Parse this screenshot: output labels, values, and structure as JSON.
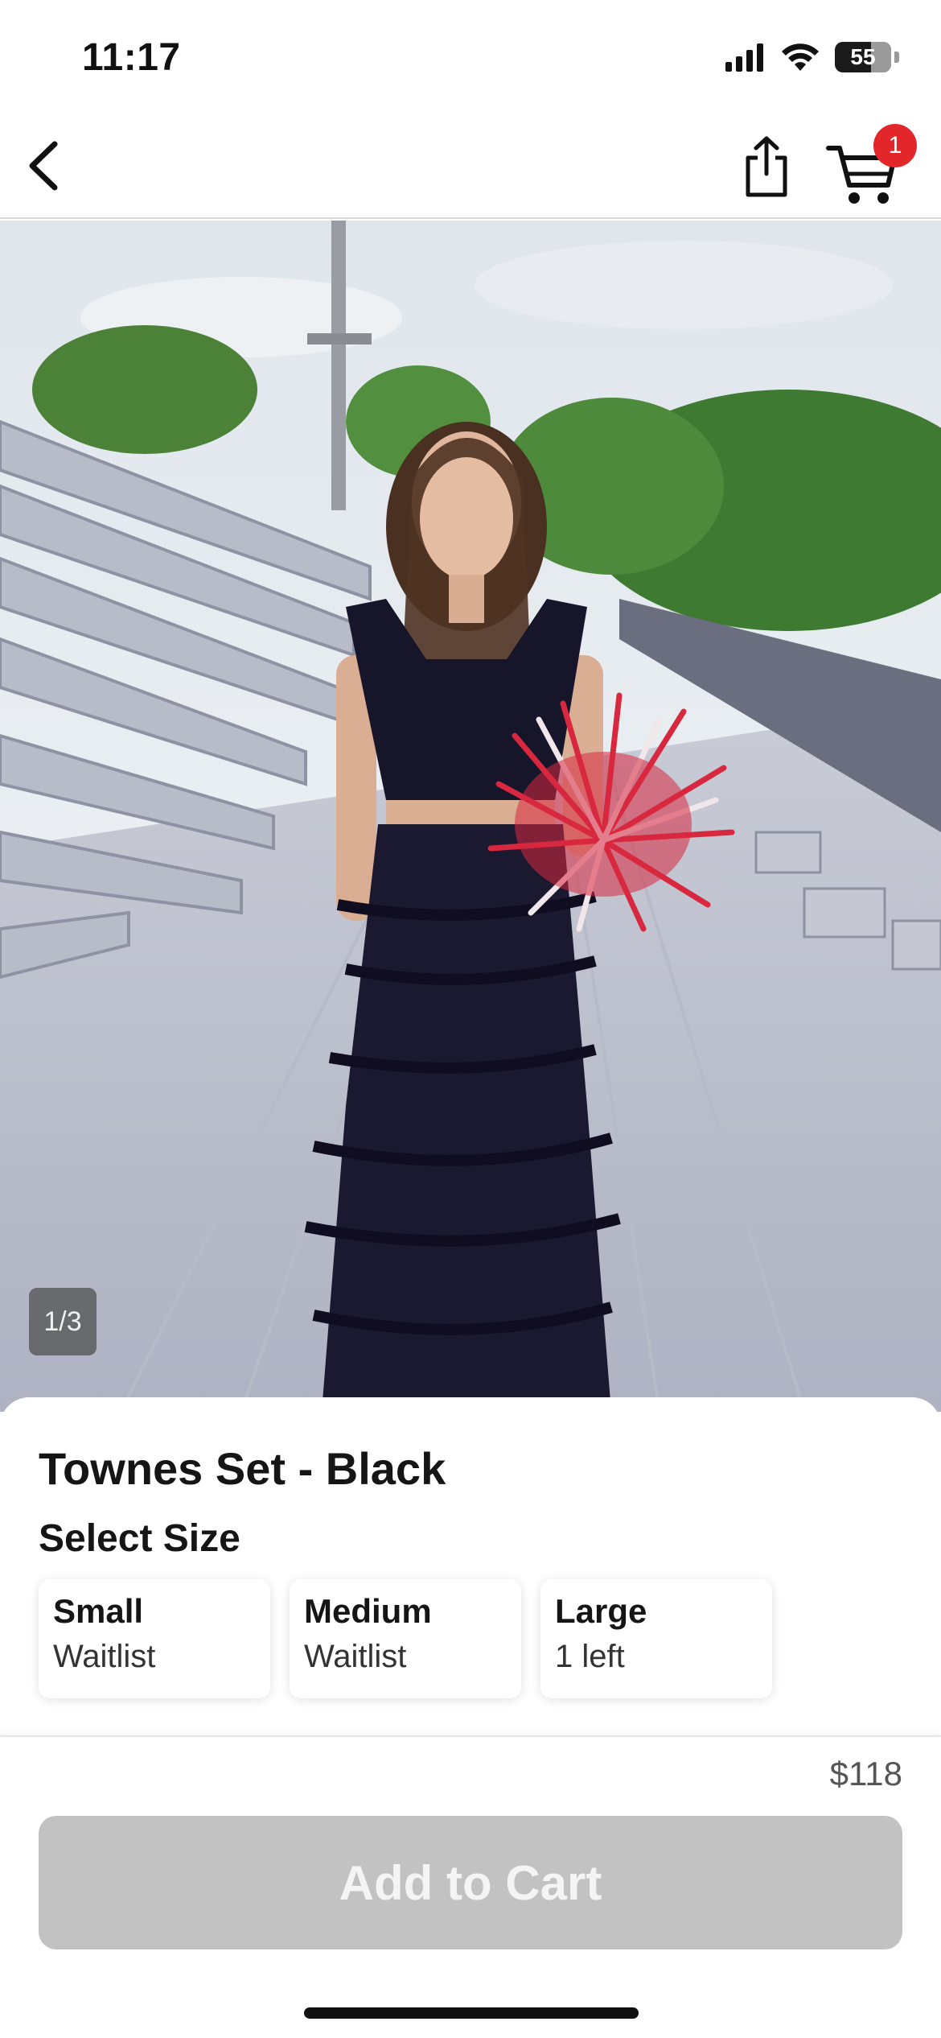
{
  "status_bar": {
    "time": "11:17",
    "battery_level": "55",
    "icons": [
      "signal-icon",
      "wifi-icon",
      "battery-icon"
    ]
  },
  "nav": {
    "back_icon": "chevron-left-icon",
    "share_icon": "share-icon",
    "cart_icon": "cart-icon",
    "cart_count": "1"
  },
  "gallery": {
    "counter": "1/3"
  },
  "product": {
    "title": "Townes Set - Black",
    "size_heading": "Select Size",
    "sizes": [
      {
        "name": "Small",
        "status": "Waitlist"
      },
      {
        "name": "Medium",
        "status": "Waitlist"
      },
      {
        "name": "Large",
        "status": "1 left"
      }
    ],
    "price": "$118",
    "add_to_cart_label": "Add to Cart"
  },
  "colors": {
    "badge": "#e3262a",
    "button_disabled": "#c2c2c2",
    "dress": "#17152a",
    "pompom": "#d8283f"
  }
}
